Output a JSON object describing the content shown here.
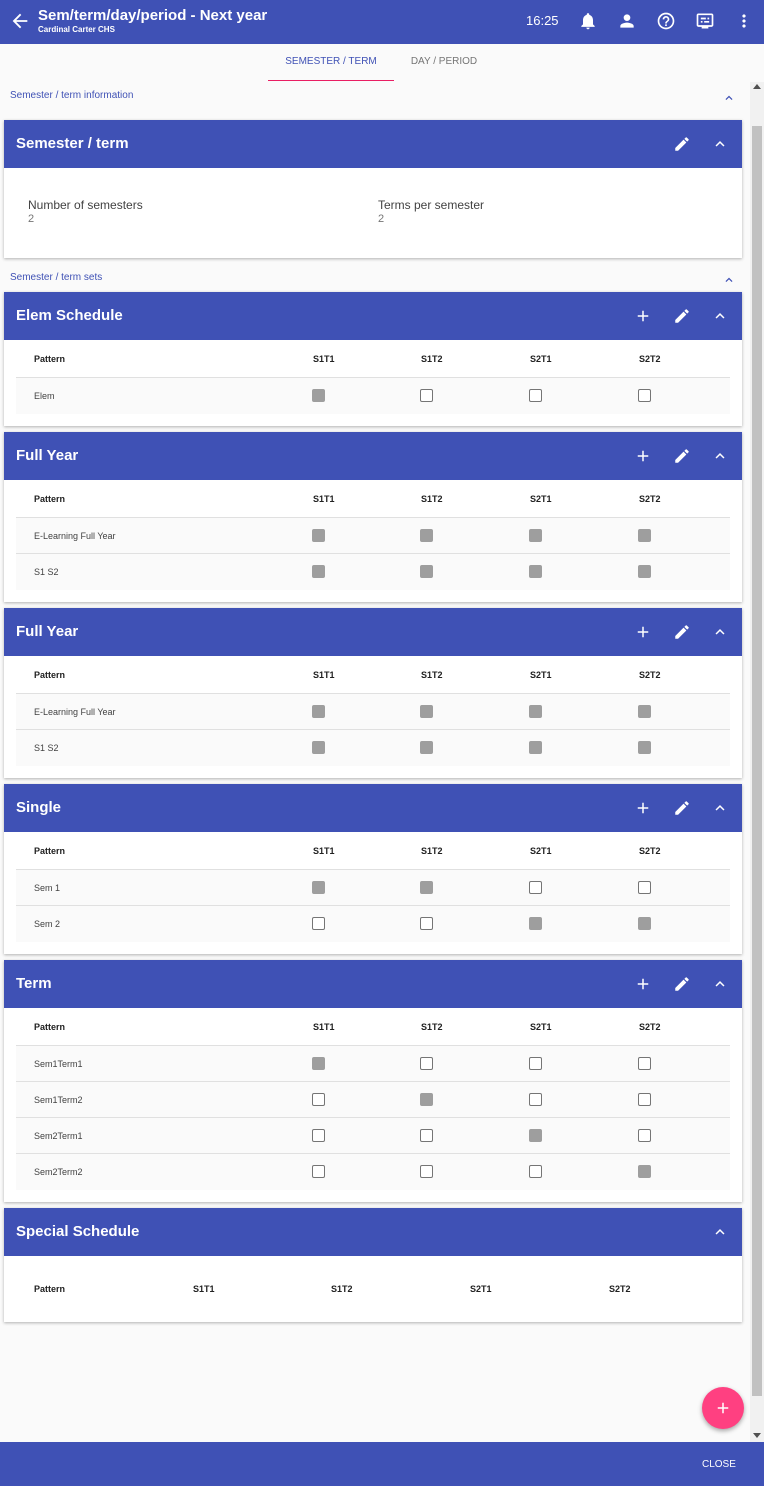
{
  "header": {
    "title": "Sem/term/day/period - Next year",
    "subtitle": "Cardinal Carter CHS",
    "time": "16:25",
    "icons": [
      "back-arrow-icon",
      "bell-icon",
      "person-icon",
      "help-icon",
      "display-settings-icon",
      "more-vert-icon"
    ]
  },
  "tabs": [
    {
      "label": "SEMESTER / TERM",
      "active": true
    },
    {
      "label": "DAY / PERIOD",
      "active": false
    }
  ],
  "info_section": {
    "label": "Semester / term information"
  },
  "semester_card": {
    "title": "Semester / term",
    "fields": [
      {
        "label": "Number of semesters",
        "value": "2"
      },
      {
        "label": "Terms per semester",
        "value": "2"
      }
    ]
  },
  "sets_section": {
    "label": "Semester / term sets"
  },
  "columns": [
    "Pattern",
    "S1T1",
    "S1T2",
    "S2T1",
    "S2T2"
  ],
  "sets": [
    {
      "title": "Elem Schedule",
      "rows": [
        {
          "pattern": "Elem",
          "checks": [
            true,
            false,
            false,
            false
          ]
        }
      ]
    },
    {
      "title": "Full Year",
      "rows": [
        {
          "pattern": "E-Learning Full Year",
          "checks": [
            true,
            true,
            true,
            true
          ]
        },
        {
          "pattern": "S1 S2",
          "checks": [
            true,
            true,
            true,
            true
          ]
        }
      ]
    },
    {
      "title": "Full Year",
      "rows": [
        {
          "pattern": "E-Learning Full Year",
          "checks": [
            true,
            true,
            true,
            true
          ]
        },
        {
          "pattern": "S1 S2",
          "checks": [
            true,
            true,
            true,
            true
          ]
        }
      ]
    },
    {
      "title": "Single",
      "rows": [
        {
          "pattern": "Sem 1",
          "checks": [
            true,
            true,
            false,
            false
          ]
        },
        {
          "pattern": "Sem 2",
          "checks": [
            false,
            false,
            true,
            true
          ]
        }
      ]
    },
    {
      "title": "Term",
      "rows": [
        {
          "pattern": "Sem1Term1",
          "checks": [
            true,
            false,
            false,
            false
          ]
        },
        {
          "pattern": "Sem1Term2",
          "checks": [
            false,
            true,
            false,
            false
          ]
        },
        {
          "pattern": "Sem2Term1",
          "checks": [
            false,
            false,
            true,
            false
          ]
        },
        {
          "pattern": "Sem2Term2",
          "checks": [
            false,
            false,
            false,
            true
          ]
        }
      ]
    }
  ],
  "special_set": {
    "title": "Special Schedule",
    "rows": []
  },
  "footer": {
    "close_label": "CLOSE"
  },
  "colors": {
    "primary": "#3f51b5",
    "accent": "#ff4081",
    "tab_indicator": "#e91e63",
    "checked": "#9e9e9e"
  }
}
